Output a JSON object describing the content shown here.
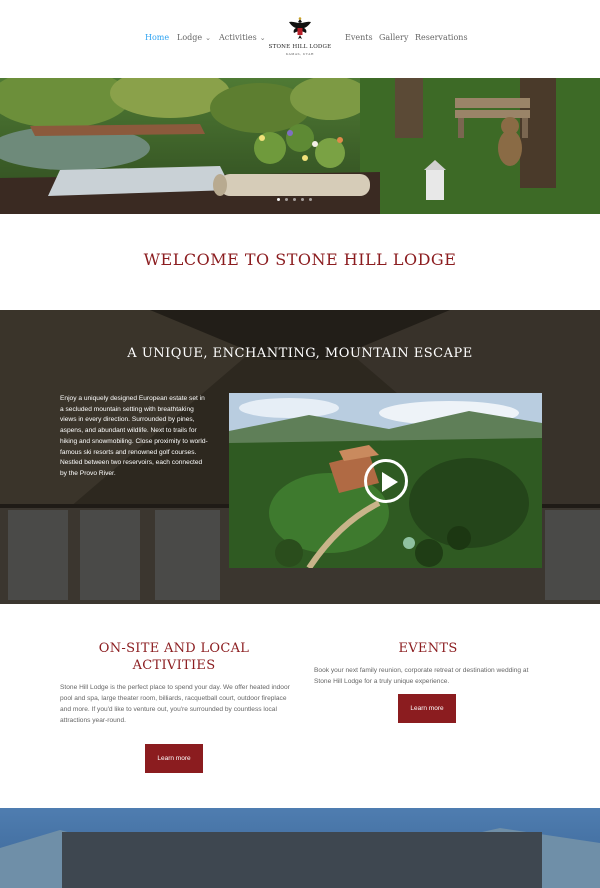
{
  "nav": {
    "home": "Home",
    "lodge": "Lodge",
    "activities": "Activities",
    "events": "Events",
    "gallery": "Gallery",
    "reservations": "Reservations",
    "chevron": "⌄"
  },
  "logo": {
    "name": "STONE HILL LODGE",
    "tagline": "KAMAS, UTAH"
  },
  "hero": {
    "slides": 5,
    "active_slide": 1
  },
  "welcome": {
    "title": "WELCOME TO STONE HILL LODGE"
  },
  "escape": {
    "title": "A UNIQUE, ENCHANTING, MOUNTAIN ESCAPE",
    "body": "Enjoy a uniquely designed European estate set in a secluded mountain setting with breathtaking views in every direction. Surrounded by pines, aspens, and abundant wildlife. Next to trails for hiking and snowmobiling. Close proximity to world-famous ski resorts and renowned golf courses. Nestled between two reservoirs, each connected by the Provo River."
  },
  "activities": {
    "title": "ON-SITE AND LOCAL ACTIVITIES",
    "body": "Stone Hill Lodge is the perfect place to spend your day. We offer heated indoor pool and spa, large theater room, billiards, racquetball court, outdoor fireplace and more. If you'd like to venture out, you're surrounded by countless local attractions year-round.",
    "button": "Learn more"
  },
  "events": {
    "title": "EVENTS",
    "body": "Book your next family reunion, corporate retreat or destination wedding at Stone Hill Lodge for a truly unique experience.",
    "button": "Learn more"
  },
  "colors": {
    "accent": "#8b1c1f",
    "nav_active": "#2ea3f2",
    "dark_section": "#2c271f"
  },
  "icons": {
    "logo": "eagle-crest-icon",
    "play": "play-icon",
    "chevron": "chevron-down-icon"
  }
}
